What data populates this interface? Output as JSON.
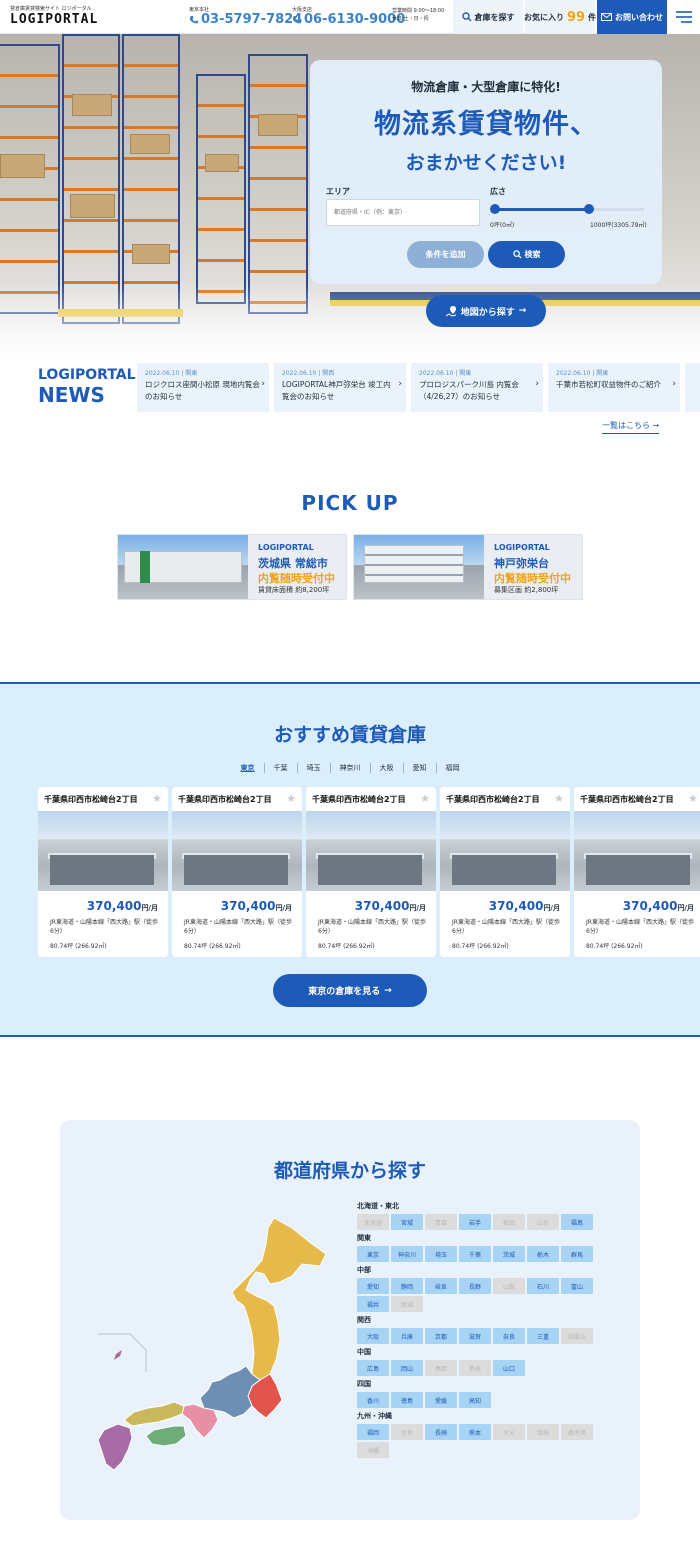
{
  "header": {
    "logo_sub": "貸倉庫賃貸検索サイト ロジポータル",
    "logo": "LOGIPORTAL",
    "tokyo_caption": "東京本社",
    "tokyo_phone": "03-5797-7824",
    "osaka_caption": "大阪支店",
    "osaka_phone": "06-6130-9000",
    "hours_line1": "営業時間 9:00〜18:00",
    "hours_line2": "休日:土・日・祝",
    "search_label": "倉庫を探す",
    "fav_label": "お気に入り",
    "fav_count": "99",
    "fav_unit": "件",
    "contact_label": "お問い合わせ"
  },
  "hero": {
    "subtitle": "物流倉庫・大型倉庫に特化!",
    "title_line1": "物流系賃貸物件、",
    "title_line2": "おまかせください!",
    "area_label": "エリア",
    "area_placeholder": "都道府県・IC（例：東京）",
    "size_label": "広さ",
    "size_min": "0坪(0㎡)",
    "size_max": "1000坪(3305.79㎡)",
    "size_value_fraction": 0.63,
    "add_condition": "条件を追加",
    "search": "検索",
    "map_search": "地図から探す"
  },
  "news": {
    "label_line1": "LOGIPORTAL",
    "label_line2": "NEWS",
    "items": [
      {
        "date": "2022.06.10 | 関東",
        "title": "ロジクロス座間小松原 現地内覧会のお知らせ"
      },
      {
        "date": "2022.06.10 | 関西",
        "title": "LOGIPORTAL神戸弥栄台 竣工内覧会のお知らせ"
      },
      {
        "date": "2022.06.10 | 関東",
        "title": "プロロジスパーク川島 内覧会（4/26,27）のお知らせ"
      },
      {
        "date": "2022.06.10 | 関東",
        "title": "千葉市若松町収益物件のご紹介"
      }
    ],
    "view_all": "一覧はこちら →"
  },
  "pickup": {
    "title": "PICK UP",
    "items": [
      {
        "brand": "LOGIPORTAL",
        "name": "茨城県 常総市",
        "status": "内覧随時受付中",
        "detail": "賃貸床面積 約8,200坪"
      },
      {
        "brand": "LOGIPORTAL",
        "name": "神戸弥栄台",
        "status": "内覧随時受付中",
        "detail": "募集区画 約2,800坪"
      }
    ]
  },
  "recommend": {
    "title": "おすすめ賃貸倉庫",
    "tabs": [
      "東京",
      "千葉",
      "埼玉",
      "神奈川",
      "大阪",
      "愛知",
      "福岡"
    ],
    "active_tab": "東京",
    "cards": [
      {
        "title": "千葉県印西市松崎台2丁目",
        "price": "370,400",
        "price_unit": "円/月",
        "access": "JR東海道・山陽本線「西大路」駅（徒歩6分）",
        "size": "80.74坪 (266.92㎡)"
      },
      {
        "title": "千葉県印西市松崎台2丁目",
        "price": "370,400",
        "price_unit": "円/月",
        "access": "JR東海道・山陽本線「西大路」駅（徒歩6分）",
        "size": "80.74坪 (266.92㎡)"
      },
      {
        "title": "千葉県印西市松崎台2丁目",
        "price": "370,400",
        "price_unit": "円/月",
        "access": "JR東海道・山陽本線「西大路」駅（徒歩6分）",
        "size": "80.74坪 (266.92㎡)"
      },
      {
        "title": "千葉県印西市松崎台2丁目",
        "price": "370,400",
        "price_unit": "円/月",
        "access": "JR東海道・山陽本線「西大路」駅（徒歩6分）",
        "size": "80.74坪 (266.92㎡)"
      },
      {
        "title": "千葉県印西市松崎台2丁目",
        "price": "370,400",
        "price_unit": "円/月",
        "access": "JR東海道・山陽本線「西大路」駅（徒歩6分）",
        "size": "80.74坪 (266.92㎡)"
      }
    ],
    "more_button": "東京の倉庫を見る"
  },
  "prefecture": {
    "title": "都道府県から探す",
    "regions": [
      {
        "name": "北海道・東北",
        "prefs": [
          {
            "n": "北海道",
            "a": false
          },
          {
            "n": "宮城",
            "a": true
          },
          {
            "n": "青森",
            "a": false
          },
          {
            "n": "岩手",
            "a": true
          },
          {
            "n": "秋田",
            "a": false
          },
          {
            "n": "山形",
            "a": false
          },
          {
            "n": "福島",
            "a": true
          }
        ]
      },
      {
        "name": "関東",
        "prefs": [
          {
            "n": "東京",
            "a": true
          },
          {
            "n": "神奈川",
            "a": true
          },
          {
            "n": "埼玉",
            "a": true
          },
          {
            "n": "千葉",
            "a": true
          },
          {
            "n": "茨城",
            "a": true
          },
          {
            "n": "栃木",
            "a": true
          },
          {
            "n": "群馬",
            "a": true
          }
        ]
      },
      {
        "name": "中部",
        "prefs": [
          {
            "n": "愛知",
            "a": true
          },
          {
            "n": "静岡",
            "a": true
          },
          {
            "n": "岐阜",
            "a": true
          },
          {
            "n": "長野",
            "a": true
          },
          {
            "n": "山梨",
            "a": false
          },
          {
            "n": "石川",
            "a": true
          },
          {
            "n": "富山",
            "a": true
          },
          {
            "n": "福井",
            "a": true
          },
          {
            "n": "新潟",
            "a": false
          }
        ]
      },
      {
        "name": "関西",
        "prefs": [
          {
            "n": "大阪",
            "a": true
          },
          {
            "n": "兵庫",
            "a": true
          },
          {
            "n": "京都",
            "a": true
          },
          {
            "n": "滋賀",
            "a": true
          },
          {
            "n": "奈良",
            "a": true
          },
          {
            "n": "三重",
            "a": true
          },
          {
            "n": "和歌山",
            "a": false
          }
        ]
      },
      {
        "name": "中国",
        "prefs": [
          {
            "n": "広島",
            "a": true
          },
          {
            "n": "岡山",
            "a": true
          },
          {
            "n": "鳥取",
            "a": false
          },
          {
            "n": "島根",
            "a": false
          },
          {
            "n": "山口",
            "a": true
          }
        ]
      },
      {
        "name": "四国",
        "prefs": [
          {
            "n": "香川",
            "a": true
          },
          {
            "n": "徳島",
            "a": true
          },
          {
            "n": "愛媛",
            "a": true
          },
          {
            "n": "高知",
            "a": true
          }
        ]
      },
      {
        "name": "九州・沖縄",
        "prefs": [
          {
            "n": "福岡",
            "a": true
          },
          {
            "n": "佐賀",
            "a": false
          },
          {
            "n": "長崎",
            "a": true
          },
          {
            "n": "熊本",
            "a": true
          },
          {
            "n": "大分",
            "a": false
          },
          {
            "n": "宮崎",
            "a": false
          },
          {
            "n": "鹿児島",
            "a": false
          },
          {
            "n": "沖縄",
            "a": false
          }
        ]
      }
    ],
    "map_colors": {
      "hokkaido_tohoku": "#e5b94a",
      "kanto": "#e2544d",
      "chubu": "#6d8fb3",
      "kansai": "#e78fa4",
      "chugoku": "#c9b85c",
      "shikoku": "#6fad78",
      "kyushu": "#a76ba5"
    }
  },
  "colors": {
    "accent": "#1e5bb8",
    "highlight": "#f2a318",
    "pale": "#dbeefb"
  }
}
